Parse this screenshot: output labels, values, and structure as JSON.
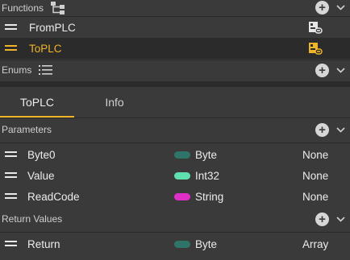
{
  "functions_section": {
    "title": "Functions",
    "icon": "tree-structure-icon"
  },
  "functions": [
    {
      "label": "FromPLC",
      "selected": false,
      "icon": "function-link-icon"
    },
    {
      "label": "ToPLC",
      "selected": true,
      "icon": "function-link-icon"
    }
  ],
  "enums_section": {
    "title": "Enums",
    "icon": "list-icon"
  },
  "tabs": [
    {
      "label": "ToPLC",
      "active": true
    },
    {
      "label": "Info",
      "active": false
    }
  ],
  "parameters_section": {
    "title": "Parameters"
  },
  "parameters": [
    {
      "name": "Byte0",
      "type": "Byte",
      "type_color": "#2f7468",
      "value": "None"
    },
    {
      "name": "Value",
      "type": "Int32",
      "type_color": "#5fe0ae",
      "value": "None"
    },
    {
      "name": "ReadCode",
      "type": "String",
      "type_color": "#e02fc8",
      "value": "None"
    }
  ],
  "return_section": {
    "title": "Return Values"
  },
  "return_values": [
    {
      "name": "Return",
      "type": "Byte",
      "type_color": "#2f7468",
      "value": "Array"
    }
  ],
  "colors": {
    "accent": "#f0b429",
    "background": "#3a3a3a",
    "selected_row": "#2b2b2b"
  }
}
